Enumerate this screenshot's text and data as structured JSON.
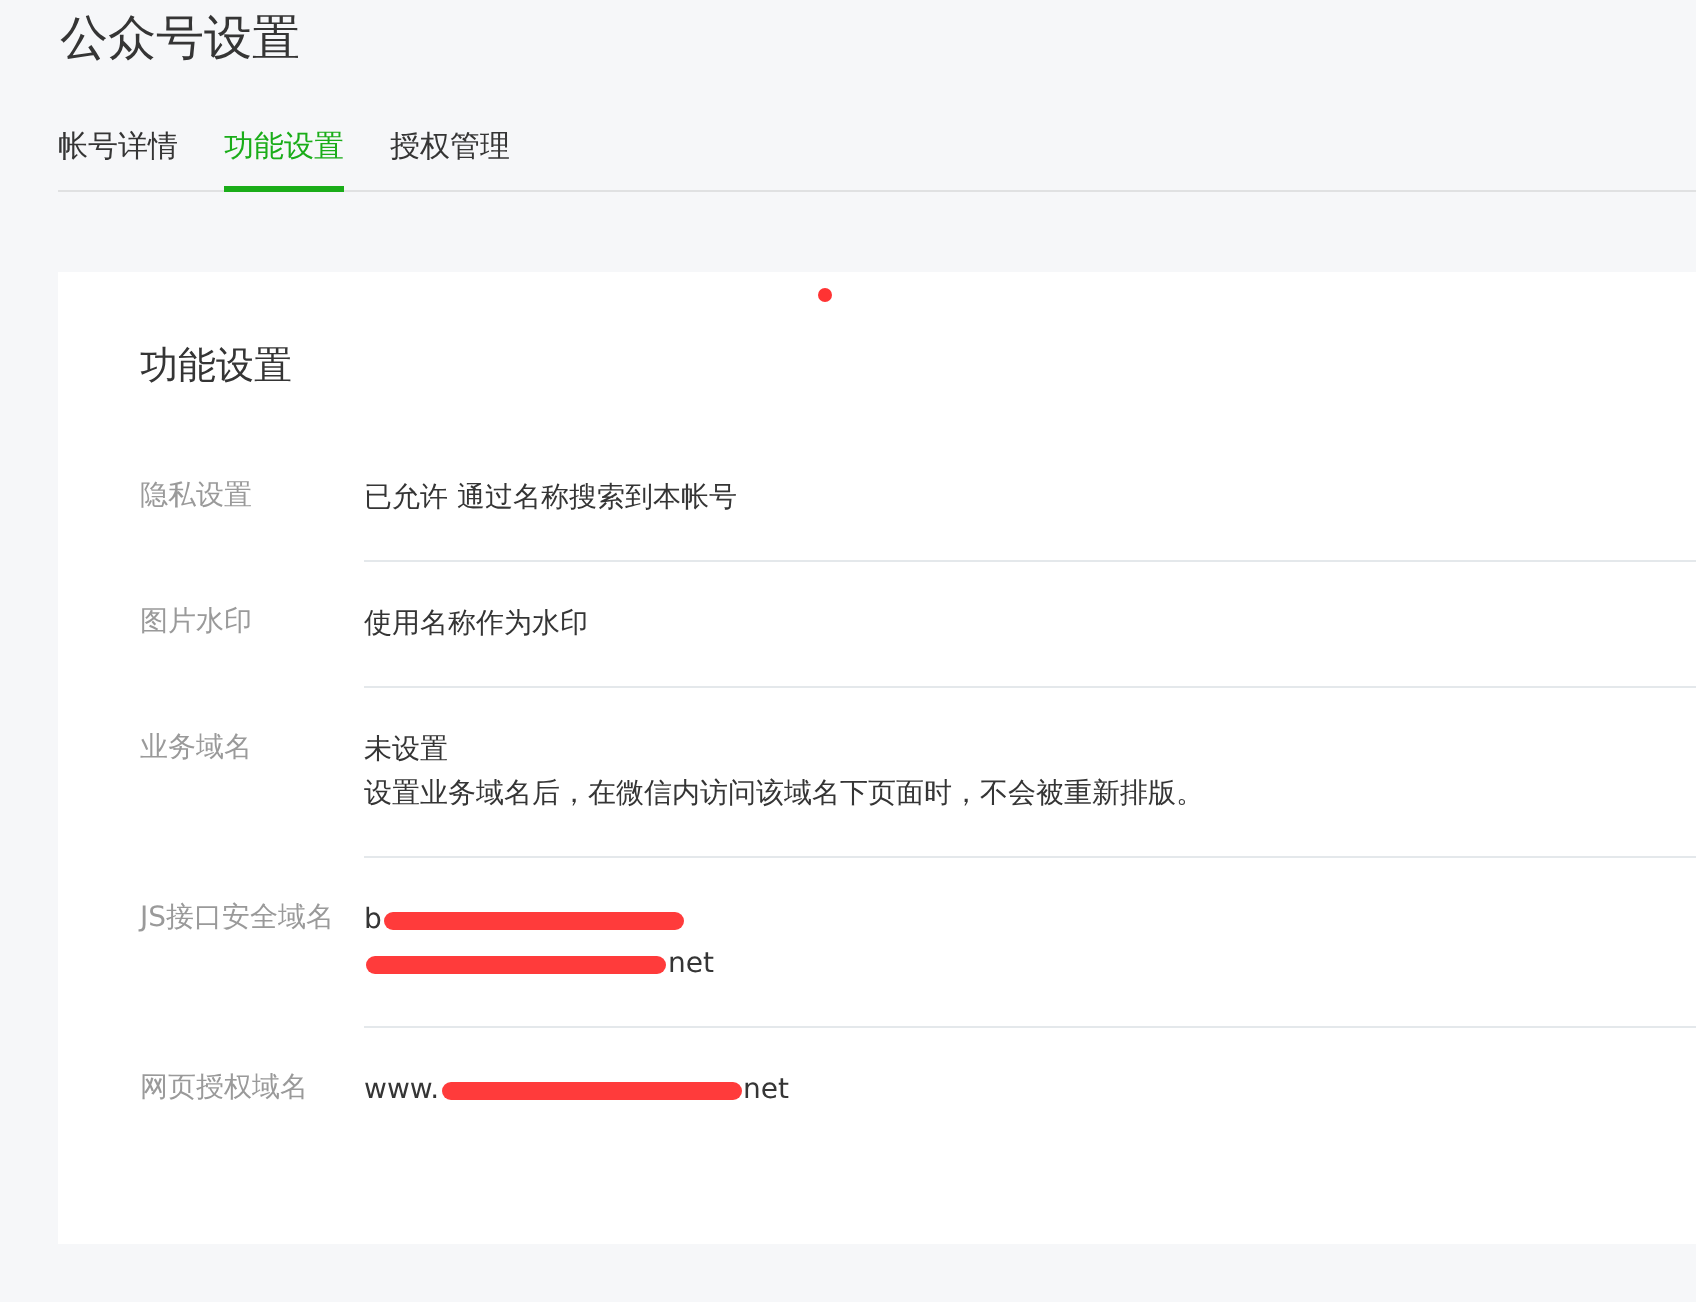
{
  "page_title": "公众号设置",
  "tabs": [
    {
      "label": "帐号详情",
      "selected": false
    },
    {
      "label": "功能设置",
      "selected": true
    },
    {
      "label": "授权管理",
      "selected": false
    }
  ],
  "section": {
    "title": "功能设置",
    "rows": [
      {
        "label": "隐私设置",
        "lines": [
          [
            {
              "kind": "text",
              "text": "已允许 通过名称搜索到本帐号"
            }
          ]
        ]
      },
      {
        "label": "图片水印",
        "lines": [
          [
            {
              "kind": "text",
              "text": "使用名称作为水印"
            }
          ]
        ]
      },
      {
        "label": "业务域名",
        "lines": [
          [
            {
              "kind": "text",
              "text": "未设置"
            }
          ],
          [
            {
              "kind": "text",
              "text": "设置业务域名后，在微信内访问该域名下页面时，不会被重新排版。"
            }
          ]
        ]
      },
      {
        "label": "JS接口安全域名",
        "lines": [
          [
            {
              "kind": "text",
              "text": "b"
            },
            {
              "kind": "redaction"
            }
          ],
          [
            {
              "kind": "redaction"
            },
            {
              "kind": "text",
              "text": "net"
            }
          ]
        ]
      },
      {
        "label": "网页授权域名",
        "lines": [
          [
            {
              "kind": "text",
              "text": "www."
            },
            {
              "kind": "redaction"
            },
            {
              "kind": "text",
              "text": "net"
            }
          ]
        ]
      }
    ]
  }
}
